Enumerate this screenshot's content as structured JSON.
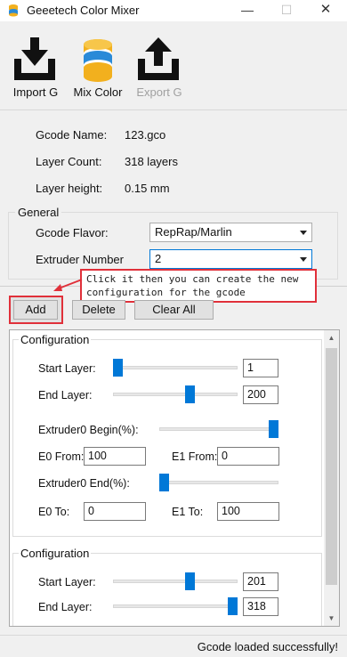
{
  "window": {
    "title": "Geeetech Color Mixer",
    "minimize": "—",
    "maximize": "☐",
    "close": "✕"
  },
  "toolbar": {
    "import_label": "Import G",
    "mix_label": "Mix Color",
    "export_label": "Export G",
    "export_enabled": false
  },
  "gcode_info": {
    "name_label": "Gcode Name:",
    "name_value": "123.gco",
    "layer_count_label": "Layer Count:",
    "layer_count_value": "318 layers",
    "layer_height_label": "Layer height:",
    "layer_height_value": "0.15 mm"
  },
  "general": {
    "title": "General",
    "flavor_label": "Gcode Flavor:",
    "flavor_value": "RepRap/Marlin",
    "extruder_label": "Extruder Number",
    "extruder_value": "2"
  },
  "annotation": {
    "tooltip_line1": "Click it then you can create the new",
    "tooltip_line2": "configuration for the gcode",
    "accent_color": "#e0303a"
  },
  "actions": {
    "add_label": "Add",
    "delete_label": "Delete",
    "clear_label": "Clear All"
  },
  "configs": [
    {
      "title": "Configuration",
      "start_label": "Start Layer:",
      "start_value": "1",
      "start_fraction": 0.0,
      "end_label": "End Layer:",
      "end_value": "200",
      "end_fraction": 0.63,
      "e0_begin_label": "Extruder0 Begin(%):",
      "e0_begin_fraction": 1.0,
      "e0_from_label": "E0 From:",
      "e0_from_value": "100",
      "e1_from_label": "E1 From:",
      "e1_from_value": "0",
      "e0_end_label": "Extruder0 End(%):",
      "e0_end_fraction": 0.0,
      "e0_to_label": "E0 To:",
      "e0_to_value": "0",
      "e1_to_label": "E1 To:",
      "e1_to_value": "100"
    },
    {
      "title": "Configuration",
      "start_label": "Start Layer:",
      "start_value": "201",
      "start_fraction": 0.63,
      "end_label": "End Layer:",
      "end_value": "318",
      "end_fraction": 1.0
    }
  ],
  "status": {
    "message": "Gcode loaded successfully!"
  },
  "colors": {
    "accent": "#0078d7",
    "highlight": "#e0303a"
  }
}
